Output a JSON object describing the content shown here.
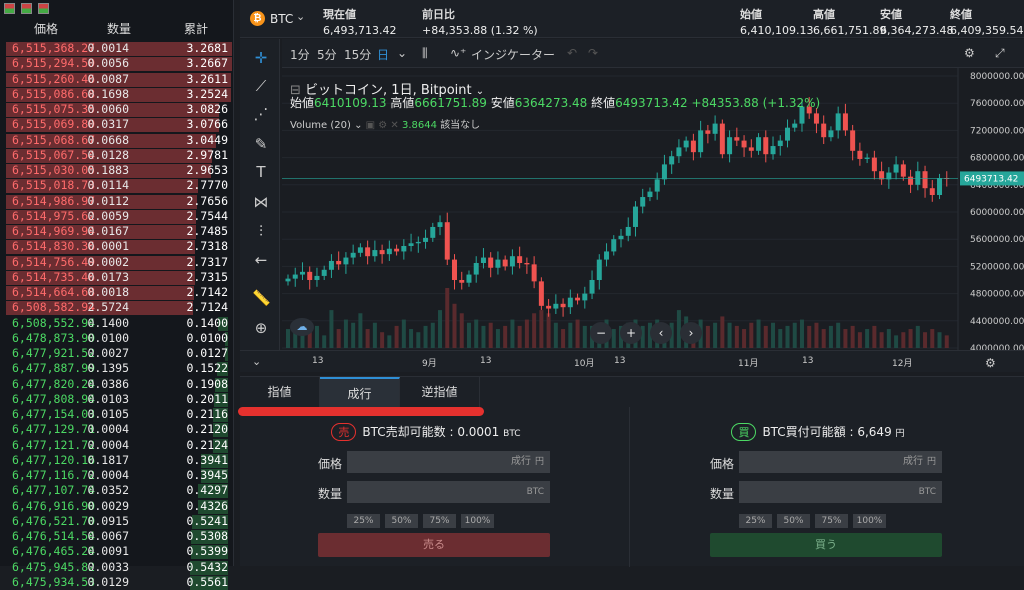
{
  "orderbook": {
    "headers": {
      "price": "価格",
      "qty": "数量",
      "cum": "累計"
    },
    "sells": [
      [
        "6,515,368.27",
        "0.0014",
        "3.2681"
      ],
      [
        "6,515,294.50",
        "0.0056",
        "3.2667"
      ],
      [
        "6,515,260.46",
        "0.0087",
        "3.2611"
      ],
      [
        "6,515,086.68",
        "0.1698",
        "3.2524"
      ],
      [
        "6,515,075.35",
        "0.0060",
        "3.0826"
      ],
      [
        "6,515,069.80",
        "0.0317",
        "3.0766"
      ],
      [
        "6,515,068.67",
        "0.0668",
        "3.0449"
      ],
      [
        "6,515,067.54",
        "0.0128",
        "2.9781"
      ],
      [
        "6,515,030.05",
        "0.1883",
        "2.9653"
      ],
      [
        "6,515,018.73",
        "0.0114",
        "2.7770"
      ],
      [
        "6,514,986.97",
        "0.0112",
        "2.7656"
      ],
      [
        "6,514,975.62",
        "0.0059",
        "2.7544"
      ],
      [
        "6,514,969.94",
        "0.0167",
        "2.7485"
      ],
      [
        "6,514,830.36",
        "0.0001",
        "2.7318"
      ],
      [
        "6,514,756.49",
        "0.0002",
        "2.7317"
      ],
      [
        "6,514,735.46",
        "0.0173",
        "2.7315"
      ],
      [
        "6,514,664.68",
        "0.0018",
        "2.7142"
      ],
      [
        "6,508,582.94",
        "2.5724",
        "2.7124"
      ]
    ],
    "buys": [
      [
        "6,508,552.94",
        "0.1400",
        "0.1400"
      ],
      [
        "6,478,873.90",
        "0.0100",
        "0.0100"
      ],
      [
        "6,477,921.52",
        "0.0027",
        "0.0127"
      ],
      [
        "6,477,887.99",
        "0.1395",
        "0.1522"
      ],
      [
        "6,477,820.24",
        "0.0386",
        "0.1908"
      ],
      [
        "6,477,808.94",
        "0.0103",
        "0.2011"
      ],
      [
        "6,477,154.03",
        "0.0105",
        "0.2116"
      ],
      [
        "6,477,129.71",
        "0.0004",
        "0.2120"
      ],
      [
        "6,477,121.72",
        "0.0004",
        "0.2124"
      ],
      [
        "6,477,120.16",
        "0.1817",
        "0.3941"
      ],
      [
        "6,477,116.72",
        "0.0004",
        "0.3945"
      ],
      [
        "6,477,107.74",
        "0.0352",
        "0.4297"
      ],
      [
        "6,476,916.90",
        "0.0029",
        "0.4326"
      ],
      [
        "6,476,521.70",
        "0.0915",
        "0.5241"
      ],
      [
        "6,476,514.54",
        "0.0067",
        "0.5308"
      ],
      [
        "6,476,465.24",
        "0.0091",
        "0.5399"
      ],
      [
        "6,475,945.82",
        "0.0033",
        "0.5432"
      ],
      [
        "6,475,934.53",
        "0.0129",
        "0.5561"
      ]
    ]
  },
  "top": {
    "symbol": "BTC",
    "coin_icon": "₿",
    "current_label": "現在値",
    "current": "6,493,713.42",
    "change_label": "前日比",
    "change": "+84,353.88 (1.32 %)",
    "open_label": "始値",
    "open": "6,410,109.13",
    "high_label": "高値",
    "high": "6,661,751.89",
    "low_label": "安値",
    "low": "6,364,273.48",
    "close_label": "終値",
    "close": "6,409,359.54"
  },
  "chart_toolbar": {
    "i1": "1分",
    "i2": "5分",
    "i3": "15分",
    "i4": "日",
    "indicator": "インジケーター"
  },
  "chart": {
    "title": "ビットコイン, 1日, Bitpoint",
    "o_label": "始値",
    "o": "6410109.13",
    "h_label": "高値",
    "h": "6661751.89",
    "l_label": "安値",
    "l": "6364273.48",
    "c_label": "終値",
    "c": "6493713.42",
    "chg": "+84353.88 (+1.32%)",
    "vol_label": "Volume (20)",
    "vol": "3.8644",
    "vol_note": "該当なし",
    "price_tag": "6493713.42"
  },
  "chart_data": {
    "type": "candlestick",
    "y_ticks": [
      "8000000.00",
      "7600000.00",
      "7200000.00",
      "6800000.00",
      "6400000.00",
      "6000000.00",
      "5600000.00",
      "5200000.00",
      "4800000.00",
      "4400000.00",
      "4000000.00"
    ],
    "ylim": [
      4000000,
      8000000
    ],
    "x_ticks": [
      "13",
      "9月",
      "13",
      "10月",
      "13",
      "11月",
      "13",
      "12月"
    ],
    "closes": [
      5020000,
      5080000,
      5120000,
      5000000,
      5060000,
      5150000,
      5280000,
      5230000,
      5330000,
      5400000,
      5480000,
      5350000,
      5440000,
      5380000,
      5460000,
      5420000,
      5500000,
      5540000,
      5560000,
      5620000,
      5780000,
      5850000,
      5300000,
      5000000,
      4960000,
      5080000,
      5250000,
      5330000,
      5180000,
      5300000,
      5200000,
      5350000,
      5250000,
      5230000,
      4980000,
      4620000,
      4580000,
      4650000,
      4600000,
      4740000,
      4700000,
      4800000,
      5000000,
      5300000,
      5420000,
      5600000,
      5650000,
      5780000,
      6080000,
      6220000,
      6300000,
      6480000,
      6700000,
      6820000,
      6950000,
      7050000,
      6880000,
      7200000,
      7150000,
      7300000,
      6850000,
      7100000,
      7050000,
      6950000,
      6900000,
      7100000,
      6850000,
      6970000,
      7050000,
      7240000,
      7300000,
      7550000,
      7450000,
      7300000,
      7100000,
      7200000,
      7450000,
      7200000,
      6900000,
      6780000,
      6800000,
      6600000,
      6480000,
      6580000,
      6700000,
      6520000,
      6400000,
      6600000,
      6350000,
      6250000,
      6500000,
      6494000
    ],
    "volumes": [
      0.6,
      0.5,
      0.8,
      0.6,
      0.7,
      0.4,
      1.2,
      0.6,
      0.9,
      0.8,
      1.1,
      0.6,
      0.8,
      0.5,
      0.4,
      0.7,
      0.9,
      0.6,
      0.5,
      0.7,
      0.8,
      1.2,
      1.9,
      1.4,
      1.1,
      0.8,
      0.9,
      0.7,
      0.8,
      0.6,
      0.7,
      0.9,
      0.7,
      0.9,
      1.1,
      1.2,
      1.1,
      0.8,
      0.6,
      0.8,
      0.9,
      0.7,
      0.7,
      0.8,
      0.9,
      0.6,
      0.7,
      0.8,
      0.9,
      0.7,
      0.8,
      0.9,
      0.7,
      0.8,
      1.2,
      1.0,
      0.8,
      0.9,
      0.7,
      0.8,
      1.0,
      0.8,
      0.7,
      0.6,
      0.8,
      0.9,
      0.7,
      0.8,
      0.6,
      0.7,
      0.8,
      0.9,
      0.7,
      0.8,
      0.6,
      0.7,
      0.8,
      0.6,
      0.7,
      0.5,
      0.6,
      0.7,
      0.5,
      0.6,
      0.4,
      0.5,
      0.6,
      0.7,
      0.5,
      0.6,
      0.5,
      0.4
    ]
  },
  "order": {
    "tabs": [
      "指値",
      "成行",
      "逆指値"
    ],
    "sell": {
      "badge": "売",
      "head": "BTC売却可能数 : 0.0001",
      "unit": "BTC",
      "price_label": "価格",
      "price_val": "成行",
      "price_unit": "円",
      "qty_label": "数量",
      "qty_unit": "BTC",
      "pcts": [
        "25%",
        "50%",
        "75%",
        "100%"
      ],
      "button": "売る"
    },
    "buy": {
      "badge": "買",
      "head": "BTC買付可能額 : 6,649",
      "unit": "円",
      "price_label": "価格",
      "price_val": "成行",
      "price_unit": "円",
      "qty_label": "数量",
      "qty_unit": "BTC",
      "pcts": [
        "25%",
        "50%",
        "75%",
        "100%"
      ],
      "button": "買う"
    }
  },
  "colors": {
    "up": "#26a69a",
    "down": "#ef5350",
    "highlight": "#e5312e"
  }
}
